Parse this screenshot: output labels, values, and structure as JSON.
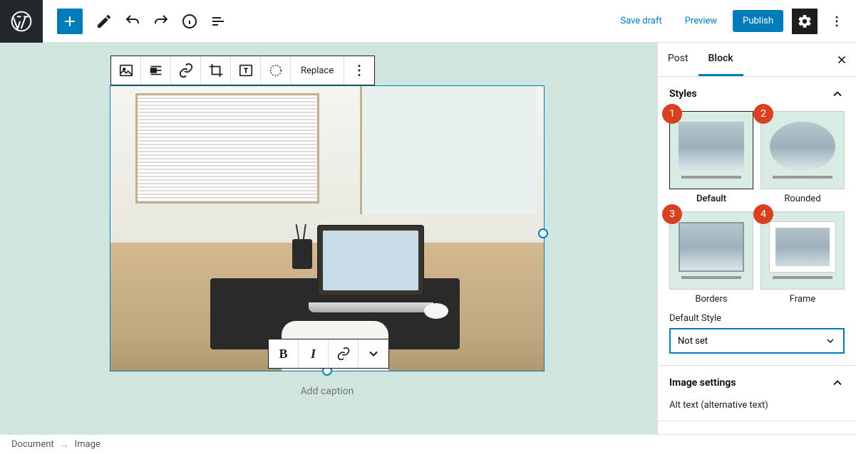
{
  "topbar": {
    "save_draft": "Save draft",
    "preview": "Preview",
    "publish": "Publish"
  },
  "block_toolbar": {
    "replace": "Replace"
  },
  "caption": {
    "placeholder": "Add caption"
  },
  "sidebar": {
    "tabs": {
      "post": "Post",
      "block": "Block"
    },
    "panels": {
      "styles": {
        "title": "Styles",
        "options": [
          {
            "label": "Default",
            "callout": "1"
          },
          {
            "label": "Rounded",
            "callout": "2"
          },
          {
            "label": "Borders",
            "callout": "3"
          },
          {
            "label": "Frame",
            "callout": "4"
          }
        ],
        "default_style_label": "Default Style",
        "default_style_value": "Not set"
      },
      "image_settings": {
        "title": "Image settings",
        "alt_text_label": "Alt text (alternative text)"
      }
    }
  },
  "breadcrumb": {
    "document": "Document",
    "image": "Image"
  }
}
